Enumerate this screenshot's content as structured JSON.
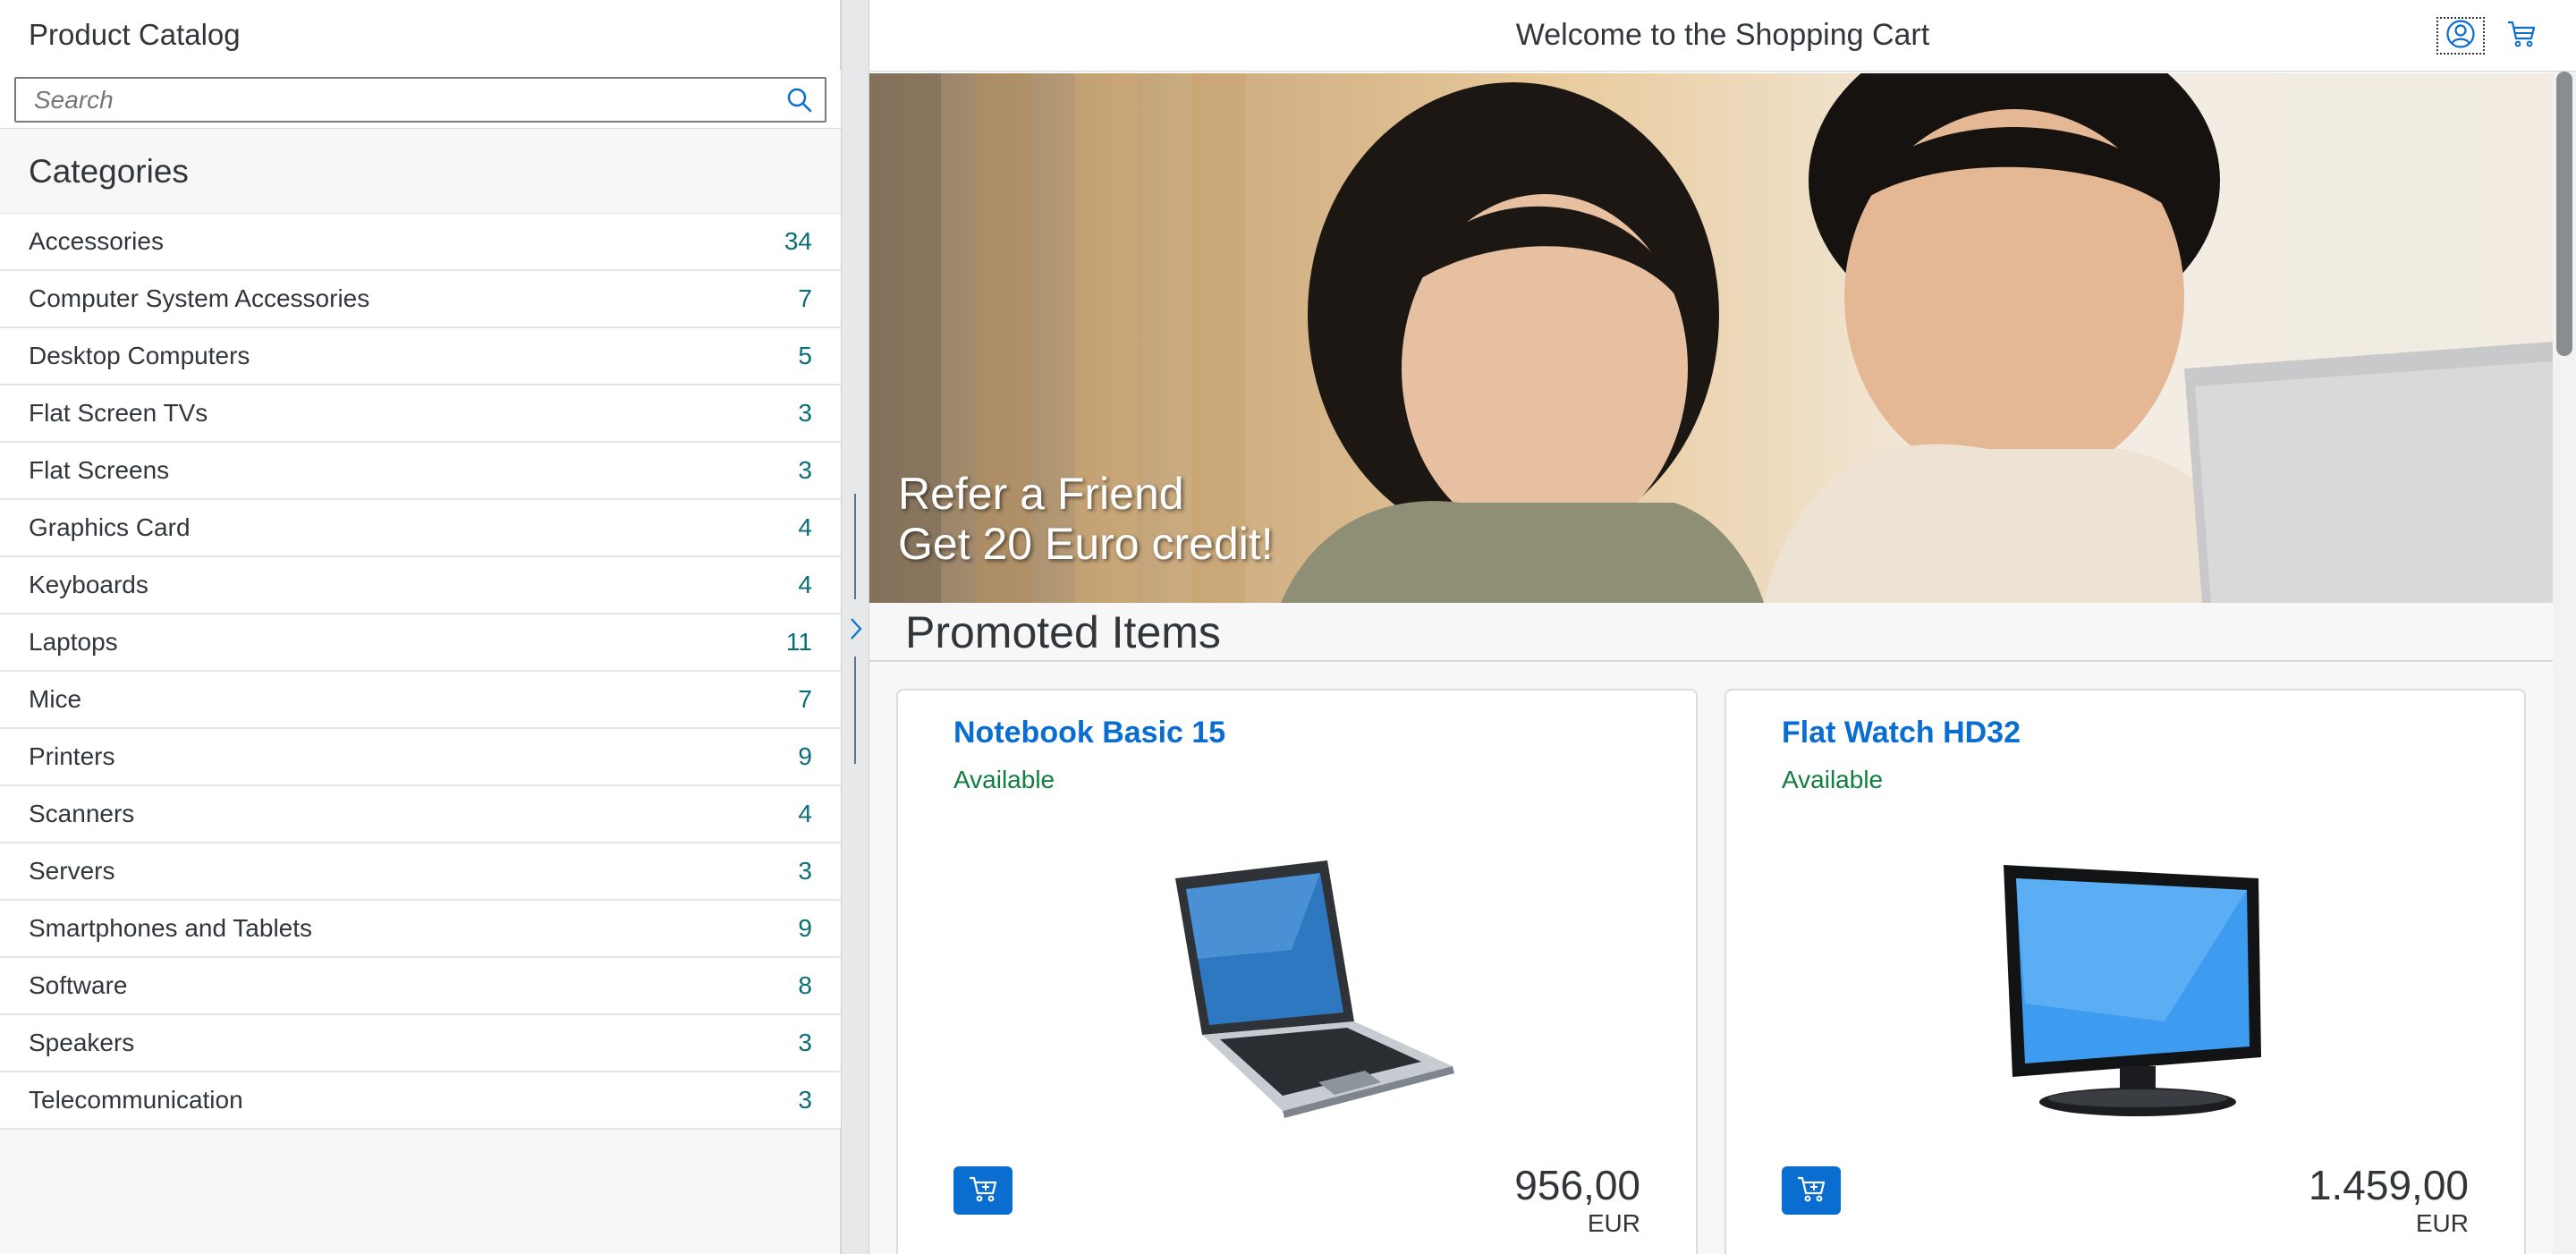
{
  "master": {
    "title": "Product Catalog",
    "search": {
      "placeholder": "Search",
      "value": ""
    },
    "categories_title": "Categories",
    "categories": [
      {
        "name": "Accessories",
        "count": "34"
      },
      {
        "name": "Computer System Accessories",
        "count": "7"
      },
      {
        "name": "Desktop Computers",
        "count": "5"
      },
      {
        "name": "Flat Screen TVs",
        "count": "3"
      },
      {
        "name": "Flat Screens",
        "count": "3"
      },
      {
        "name": "Graphics Card",
        "count": "4"
      },
      {
        "name": "Keyboards",
        "count": "4"
      },
      {
        "name": "Laptops",
        "count": "11"
      },
      {
        "name": "Mice",
        "count": "7"
      },
      {
        "name": "Printers",
        "count": "9"
      },
      {
        "name": "Scanners",
        "count": "4"
      },
      {
        "name": "Servers",
        "count": "3"
      },
      {
        "name": "Smartphones and Tablets",
        "count": "9"
      },
      {
        "name": "Software",
        "count": "8"
      },
      {
        "name": "Speakers",
        "count": "3"
      },
      {
        "name": "Telecommunication",
        "count": "3"
      }
    ]
  },
  "detail": {
    "title": "Welcome to the Shopping Cart",
    "hero": {
      "line1": "Refer a Friend",
      "line2": "Get 20 Euro credit!"
    },
    "promoted_title": "Promoted Items",
    "products": [
      {
        "name": "Notebook Basic 15",
        "status": "Available",
        "price": "956,00",
        "currency": "EUR",
        "image": "laptop"
      },
      {
        "name": "Flat Watch HD32",
        "status": "Available",
        "price": "1.459,00",
        "currency": "EUR",
        "image": "monitor"
      }
    ]
  },
  "icons": {
    "search": "search-icon",
    "user": "user-icon",
    "cart": "cart-icon",
    "add_to_cart": "add-to-cart-icon",
    "splitter_toggle": "chevron-right-icon"
  },
  "colors": {
    "accent": "#0a6ed1",
    "status_available": "#107e3e",
    "count": "#0a6e7a",
    "text": "#32363a"
  }
}
